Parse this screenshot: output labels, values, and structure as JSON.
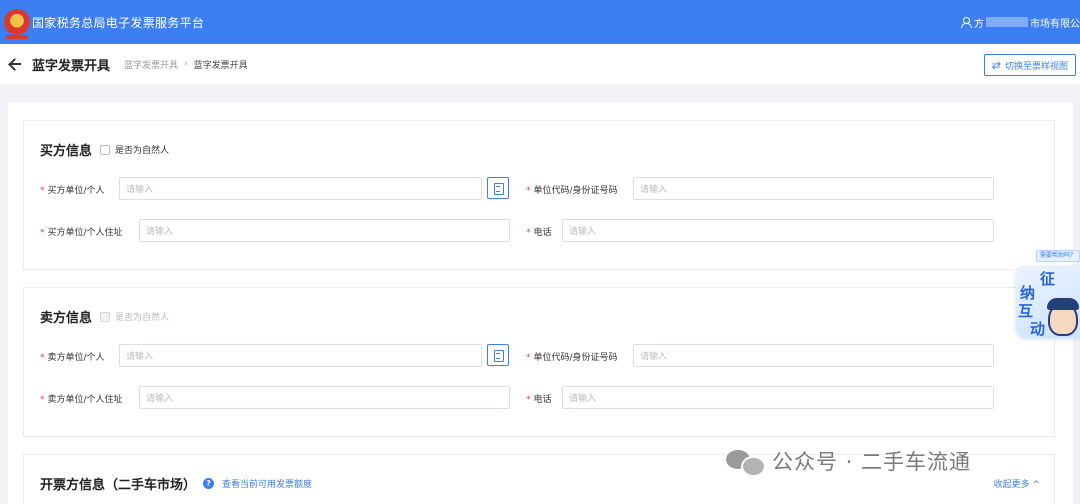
{
  "topbar": {
    "brand": "国家税务总局电子发票服务平台",
    "user_prefix": "方",
    "user_suffix": "市场有限公"
  },
  "subheader": {
    "title": "蓝字发票开具",
    "breadcrumbs": [
      "蓝字发票开具",
      "蓝字发票开具"
    ],
    "breadcrumb_sep": "›",
    "switch_button": "切换至票样视图"
  },
  "buyer": {
    "title": "买方信息",
    "natural_person": "是否为自然人",
    "fields": {
      "name_label": "买方单位/个人",
      "name_placeholder": "请输入",
      "code_label": "单位代码/身份证号码",
      "code_placeholder": "请输入",
      "address_label": "买方单位/个人住址",
      "address_placeholder": "请输入",
      "phone_label": "电话",
      "phone_placeholder": "请输入"
    }
  },
  "seller": {
    "title": "卖方信息",
    "natural_person": "是否为自然人",
    "fields": {
      "name_label": "卖方单位/个人",
      "name_placeholder": "请输入",
      "code_label": "单位代码/身份证号码",
      "code_placeholder": "请输入",
      "address_label": "卖方单位/个人住址",
      "address_placeholder": "请输入",
      "phone_label": "电话",
      "phone_placeholder": "请输入"
    }
  },
  "invoice": {
    "title": "开票方信息（二手车市场）",
    "quota_link": "查看当前可用发票额度",
    "collapse": "收起更多"
  },
  "float_assistant": {
    "badge": "需要帮助吗？",
    "chars": [
      "征",
      "纳",
      "互",
      "动"
    ]
  },
  "watermark": "公众号 · 二手车流通",
  "colors": {
    "primary": "#3d7ff2",
    "required": "#e5484d"
  }
}
